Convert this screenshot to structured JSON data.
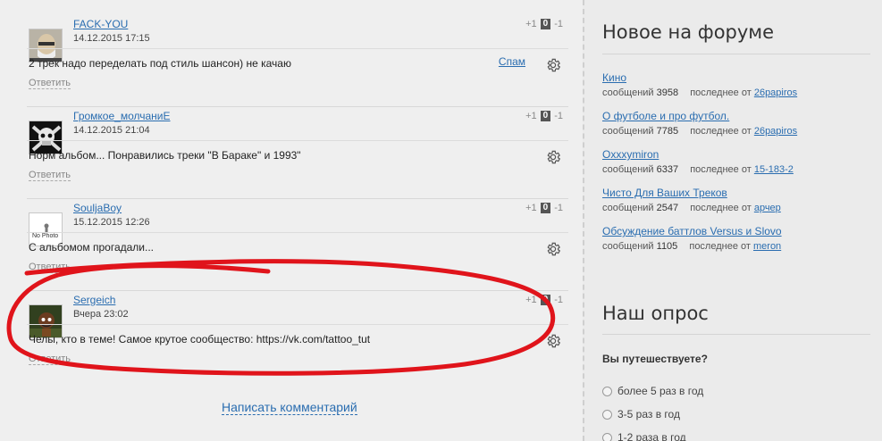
{
  "comments": [
    {
      "author": "FACK-YOU",
      "date": "14.12.2015 17:15",
      "text": "2 трек надо переделать под стиль шансон) не качаю",
      "reply": "Ответить",
      "spam": "Спам",
      "plus": "+1",
      "score": "0",
      "minus": "-1"
    },
    {
      "author": "Громкое_молчаниЕ",
      "date": "14.12.2015 21:04",
      "text": "Норм альбом... Понравились треки \"В Бараке\" и 1993\"",
      "reply": "Ответить",
      "plus": "+1",
      "score": "0",
      "minus": "-1"
    },
    {
      "author": "SouljaBoy",
      "date": "15.12.2015 12:26",
      "text": "С альбомом прогадали...",
      "reply": "Ответить",
      "plus": "+1",
      "score": "0",
      "minus": "-1",
      "avatar_text": "No Photo"
    },
    {
      "author": "Sergeich",
      "date": "Вчера 23:02",
      "text": "Челы, кто в теме! Самое крутое сообщество: https://vk.com/tattoo_tut",
      "reply": "Ответить",
      "plus": "+1",
      "score": "0",
      "minus": "-1"
    }
  ],
  "write_comment": "Написать комментарий",
  "sidebar": {
    "forum_title": "Новое на форуме",
    "messages_label": "сообщений",
    "last_label": "последнее от",
    "topics": [
      {
        "title": "Кино",
        "count": "3958",
        "last_user": "26papiros"
      },
      {
        "title": "О футболе и про футбол.",
        "count": "7785",
        "last_user": "26papiros"
      },
      {
        "title": "Oxxxymiron",
        "count": "6337",
        "last_user": "15-183-2"
      },
      {
        "title": "Чисто Для Ваших Треков",
        "count": "2547",
        "last_user": "арчер"
      },
      {
        "title": "Обсуждение баттлов Versus и Slovo",
        "count": "1105",
        "last_user": "meron"
      }
    ],
    "poll_title": "Наш опрос",
    "poll_question": "Вы путешествуете?",
    "poll_options": [
      "более 5 раз в год",
      "3-5 раз в год",
      "1-2 раза в год"
    ]
  },
  "colors": {
    "link": "#2a6db0",
    "annotation": "#e0141b",
    "score_bg": "#555555"
  }
}
